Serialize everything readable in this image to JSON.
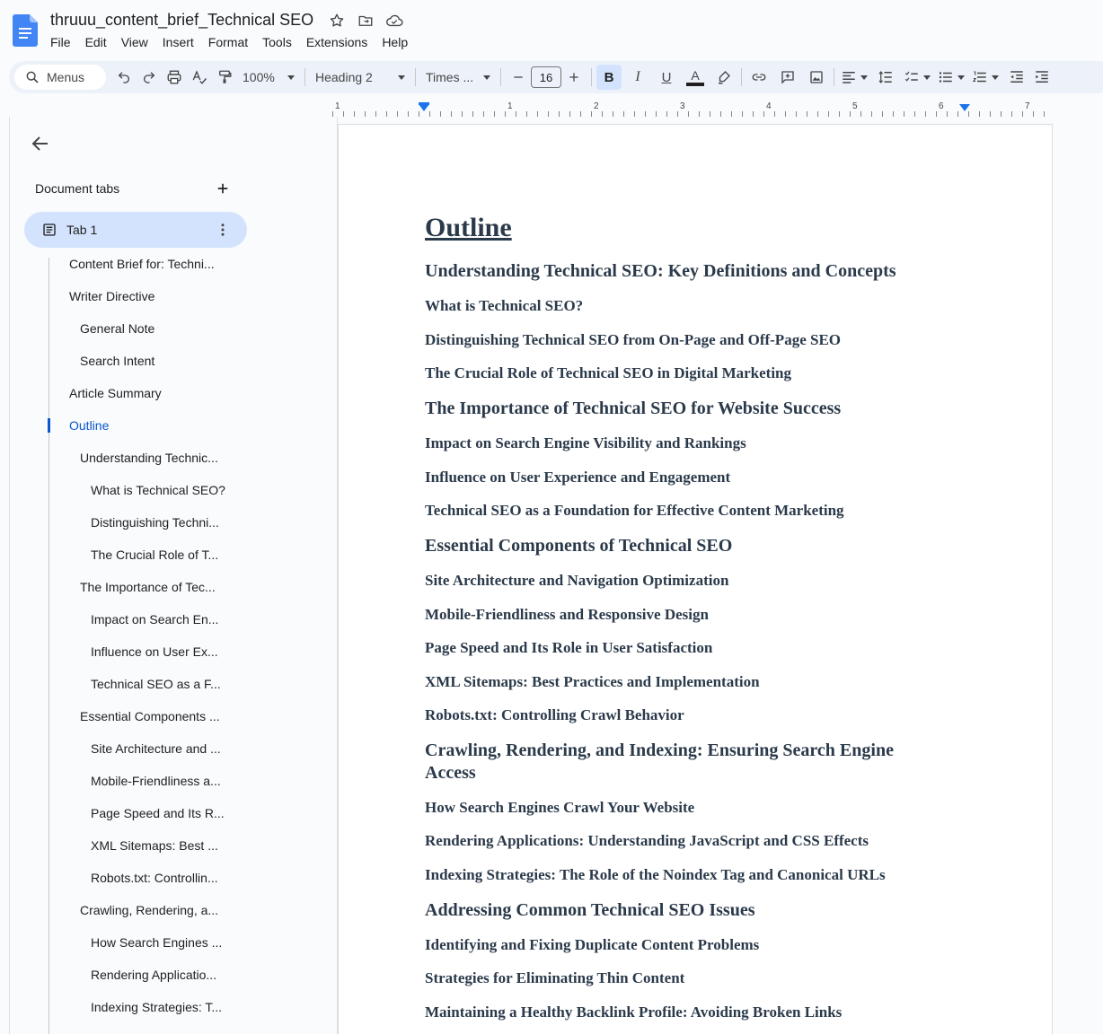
{
  "app": {
    "title": "thruuu_content_brief_Technical SEO",
    "menus": [
      "File",
      "Edit",
      "View",
      "Insert",
      "Format",
      "Tools",
      "Extensions",
      "Help"
    ]
  },
  "toolbar": {
    "search_label": "Menus",
    "zoom": "100%",
    "style": "Heading 2",
    "font": "Times ...",
    "font_size": "16",
    "bold_label": "B",
    "italic_label": "I",
    "underline_label": "U",
    "text_color_label": "A"
  },
  "ruler": {
    "labels": [
      "1",
      "1",
      "2",
      "3",
      "4",
      "5",
      "6",
      "7"
    ]
  },
  "panel": {
    "heading": "Document tabs",
    "tab_label": "Tab 1",
    "outline": [
      "Content Brief for: Techni...",
      "Writer Directive",
      "General Note",
      "Search Intent",
      "Article Summary",
      "Outline",
      "Understanding Technic...",
      "What is Technical SEO?",
      "Distinguishing Techni...",
      "The Crucial Role of T...",
      "The Importance of Tec...",
      "Impact on Search En...",
      "Influence on User Ex...",
      "Technical SEO as a F...",
      "Essential Components ...",
      "Site Architecture and ...",
      "Mobile-Friendliness a...",
      "Page Speed and Its R...",
      "XML Sitemaps: Best ...",
      "Robots.txt: Controllin...",
      "Crawling, Rendering, a...",
      "How Search Engines ...",
      "Rendering Applicatio...",
      "Indexing Strategies: T..."
    ]
  },
  "document": {
    "title": "Outline",
    "headings": [
      "Understanding Technical SEO: Key Definitions and Concepts",
      "What is Technical SEO?",
      "Distinguishing Technical SEO from On-Page and Off-Page SEO",
      "The Crucial Role of Technical SEO in Digital Marketing",
      "The Importance of Technical SEO for Website Success",
      "Impact on Search Engine Visibility and Rankings",
      "Influence on User Experience and Engagement",
      "Technical SEO as a Foundation for Effective Content Marketing",
      "Essential Components of Technical SEO",
      "Site Architecture and Navigation Optimization",
      "Mobile-Friendliness and Responsive Design",
      "Page Speed and Its Role in User Satisfaction",
      "XML Sitemaps: Best Practices and Implementation",
      "Robots.txt: Controlling Crawl Behavior",
      "Crawling, Rendering, and Indexing: Ensuring Search Engine",
      "Access",
      "How Search Engines Crawl Your Website",
      "Rendering Applications: Understanding JavaScript and CSS Effects",
      "Indexing Strategies: The Role of the Noindex Tag and Canonical URLs",
      "Addressing Common Technical SEO Issues",
      "Identifying and Fixing Duplicate Content Problems",
      "Strategies for Eliminating Thin Content",
      "Maintaining a Healthy Backlink Profile: Avoiding Broken Links"
    ]
  }
}
